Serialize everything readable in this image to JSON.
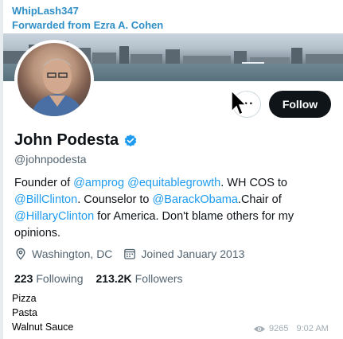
{
  "message": {
    "sender": "WhipLash347",
    "forwarded_from": "Forwarded from Ezra A. Cohen",
    "caption_lines": [
      "Pizza",
      "Pasta",
      "Walnut Sauce"
    ],
    "views": "9265",
    "time": "9:02 AM"
  },
  "profile": {
    "name": "John Podesta",
    "handle": "@johnpodesta",
    "more_label": "···",
    "follow_label": "Follow",
    "bio": {
      "t1": "Founder of ",
      "m1": "@amprog",
      "t2": " ",
      "m2": "@equitablegrowth",
      "t3": ". WH COS to ",
      "m3": "@BillClinton",
      "t4": ". Counselor to ",
      "m4": "@BarackObama",
      "t5": ".Chair of ",
      "m5": "@HillaryClinton",
      "t6": " for America. Don't blame others for my opinions."
    },
    "location": "Washington, DC",
    "joined": "Joined January 2013",
    "following_count": "223",
    "following_label": "Following",
    "followers_count": "213.2K",
    "followers_label": "Followers"
  },
  "colors": {
    "accent": "#1d9bf0",
    "telegram_name": "#2f8fc7",
    "follow_bg": "#0f1419"
  },
  "icons": [
    "verified-badge-icon",
    "location-pin-icon",
    "calendar-icon",
    "eye-icon",
    "mouse-cursor-icon"
  ]
}
